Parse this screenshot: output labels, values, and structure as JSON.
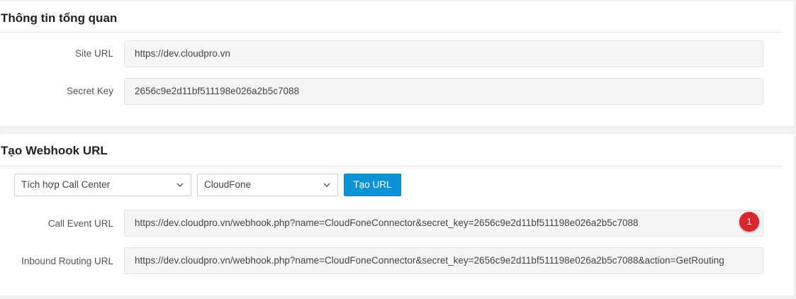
{
  "overview": {
    "title": "Thông tin tổng quan",
    "site_url_label": "Site URL",
    "site_url_value": "https://dev.cloudpro.vn",
    "secret_key_label": "Secret Key",
    "secret_key_value": "2656c9e2d11bf511198e026a2b5c7088"
  },
  "webhook": {
    "title": "Tạo Webhook URL",
    "integration_select": "Tích hợp Call Center",
    "provider_select": "CloudFone",
    "create_button": "Tạo URL",
    "call_event_label": "Call Event URL",
    "call_event_value": "https://dev.cloudpro.vn/webhook.php?name=CloudFoneConnector&secret_key=2656c9e2d11bf511198e026a2b5c7088",
    "inbound_label": "Inbound Routing URL",
    "inbound_value": "https://dev.cloudpro.vn/webhook.php?name=CloudFoneConnector&secret_key=2656c9e2d11bf511198e026a2b5c7088&action=GetRouting",
    "badge": "1"
  },
  "colors": {
    "button": "#0b93d5",
    "badge": "#d9262c",
    "field_bg": "#f5f5f5"
  },
  "icons": [
    "chevron-down-icon"
  ]
}
